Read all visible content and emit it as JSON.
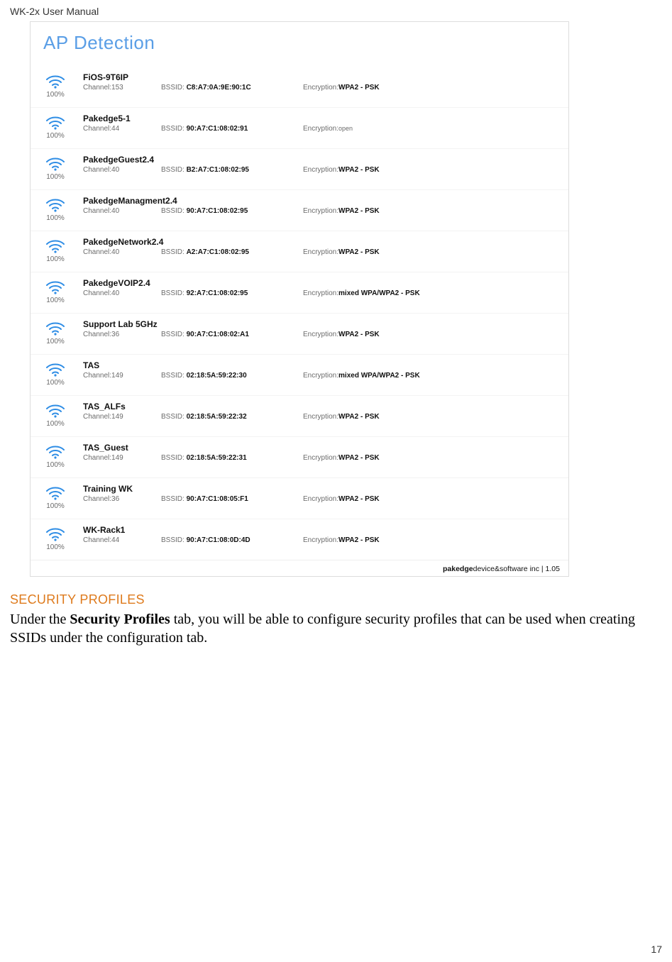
{
  "doc_header": "WK-2x User Manual",
  "page_number": "17",
  "screenshot": {
    "panel_title": "AP Detection",
    "footer_brand_bold": "pakedge",
    "footer_brand_rest": "device&software inc | 1.05",
    "rows": [
      {
        "signal": "100%",
        "ssid": "FiOS-9T6IP",
        "channel": "153",
        "bssid": "C8:A7:0A:9E:90:1C",
        "encryption": "WPA2 - PSK",
        "enc_open": false
      },
      {
        "signal": "100%",
        "ssid": "Pakedge5-1",
        "channel": "44",
        "bssid": "90:A7:C1:08:02:91",
        "encryption": "open",
        "enc_open": true
      },
      {
        "signal": "100%",
        "ssid": "PakedgeGuest2.4",
        "channel": "40",
        "bssid": "B2:A7:C1:08:02:95",
        "encryption": "WPA2 - PSK",
        "enc_open": false
      },
      {
        "signal": "100%",
        "ssid": "PakedgeManagment2.4",
        "channel": "40",
        "bssid": "90:A7:C1:08:02:95",
        "encryption": "WPA2 - PSK",
        "enc_open": false
      },
      {
        "signal": "100%",
        "ssid": "PakedgeNetwork2.4",
        "channel": "40",
        "bssid": "A2:A7:C1:08:02:95",
        "encryption": "WPA2 - PSK",
        "enc_open": false
      },
      {
        "signal": "100%",
        "ssid": "PakedgeVOIP2.4",
        "channel": "40",
        "bssid": "92:A7:C1:08:02:95",
        "encryption": "mixed WPA/WPA2 - PSK",
        "enc_open": false
      },
      {
        "signal": "100%",
        "ssid": "Support Lab 5GHz",
        "channel": "36",
        "bssid": "90:A7:C1:08:02:A1",
        "encryption": "WPA2 - PSK",
        "enc_open": false
      },
      {
        "signal": "100%",
        "ssid": "TAS",
        "channel": "149",
        "bssid": "02:18:5A:59:22:30",
        "encryption": "mixed WPA/WPA2 - PSK",
        "enc_open": false
      },
      {
        "signal": "100%",
        "ssid": "TAS_ALFs",
        "channel": "149",
        "bssid": "02:18:5A:59:22:32",
        "encryption": "WPA2 - PSK",
        "enc_open": false
      },
      {
        "signal": "100%",
        "ssid": "TAS_Guest",
        "channel": "149",
        "bssid": "02:18:5A:59:22:31",
        "encryption": "WPA2 - PSK",
        "enc_open": false
      },
      {
        "signal": "100%",
        "ssid": "Training WK",
        "channel": "36",
        "bssid": "90:A7:C1:08:05:F1",
        "encryption": "WPA2 - PSK",
        "enc_open": false
      },
      {
        "signal": "100%",
        "ssid": "WK-Rack1",
        "channel": "44",
        "bssid": "90:A7:C1:08:0D:4D",
        "encryption": "WPA2 - PSK",
        "enc_open": false
      }
    ],
    "labels": {
      "channel": "Channel:",
      "bssid": "BSSID:",
      "encryption": "Encryption:"
    }
  },
  "section": {
    "heading": "SECURITY PROFILES",
    "para_pre": "Under the ",
    "para_bold": "Security Profiles",
    "para_post": " tab, you will be able to configure security profiles that can be used when creating SSIDs under the configuration tab."
  }
}
